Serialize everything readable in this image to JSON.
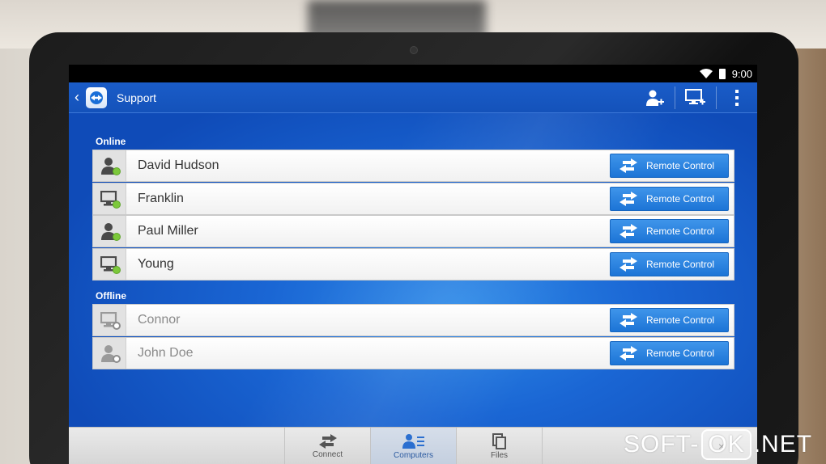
{
  "status_bar": {
    "time": "9:00"
  },
  "app_bar": {
    "title": "Support",
    "logo_icon": "teamviewer-logo-icon",
    "actions": [
      "add-contact-icon",
      "add-computer-icon",
      "overflow-menu-icon"
    ]
  },
  "sections": {
    "online_label": "Online",
    "offline_label": "Offline"
  },
  "online": [
    {
      "name": "David Hudson",
      "kind": "person-icon",
      "button": "Remote Control"
    },
    {
      "name": "Franklin",
      "kind": "monitor-icon",
      "button": "Remote Control"
    },
    {
      "name": "Paul Miller",
      "kind": "person-icon",
      "button": "Remote Control"
    },
    {
      "name": "Young",
      "kind": "monitor-icon",
      "button": "Remote Control"
    }
  ],
  "offline": [
    {
      "name": "Connor",
      "kind": "monitor-icon",
      "button": "Remote Control"
    },
    {
      "name": "John Doe",
      "kind": "person-icon",
      "button": "Remote Control"
    }
  ],
  "bottom_tabs": [
    {
      "label": "Connect",
      "icon": "arrows-icon",
      "active": false
    },
    {
      "label": "Computers",
      "icon": "contacts-list-icon",
      "active": true
    },
    {
      "label": "Files",
      "icon": "files-icon",
      "active": false
    }
  ],
  "watermark": {
    "left": "SOFT-",
    "box": "OK",
    "right": ".NET"
  },
  "colors": {
    "app_blue": "#1452ba",
    "button_blue": "#1c74d6",
    "online_green": "#7cc83a"
  }
}
